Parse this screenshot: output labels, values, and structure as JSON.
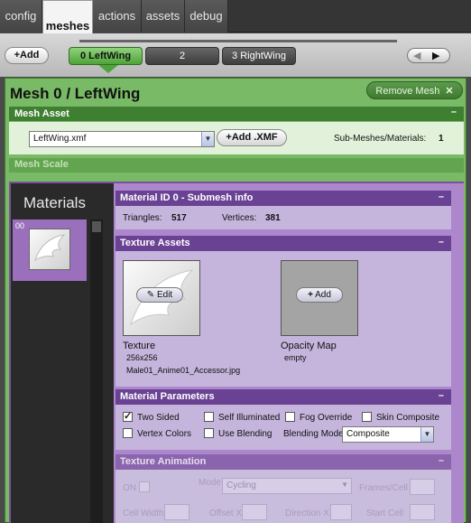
{
  "tabs": [
    "config",
    "meshes",
    "actions",
    "assets",
    "debug"
  ],
  "add_label": "Add",
  "mesh_tabs": [
    "0 LeftWing",
    "2",
    "3 RightWing"
  ],
  "title": "Mesh 0 / LeftWing",
  "remove_mesh": "Remove Mesh",
  "mesh_asset": {
    "header": "Mesh Asset",
    "file": "LeftWing.xmf",
    "add_xmf": "Add .XMF",
    "submesh_label": "Sub-Meshes/Materials:",
    "submesh_count": "1"
  },
  "mesh_scale": "Mesh Scale",
  "materials": {
    "title": "Materials",
    "thumb_index": "00"
  },
  "submesh": {
    "header": "Material ID 0 - Submesh info",
    "triangles_label": "Triangles:",
    "triangles": "517",
    "vertices_label": "Vertices:",
    "vertices": "381"
  },
  "texture_assets": {
    "header": "Texture Assets",
    "edit": "Edit",
    "texture_label": "Texture",
    "texture_size": "256x256",
    "texture_file": "Male01_Anime01_Accessor.jpg",
    "add": "Add",
    "opacity_label": "Opacity Map",
    "opacity_value": "empty"
  },
  "params": {
    "header": "Material Parameters",
    "two_sided": "Two Sided",
    "self_illuminated": "Self Illuminated",
    "fog_override": "Fog Override",
    "skin_composite": "Skin Composite",
    "vertex_colors": "Vertex Colors",
    "use_blending": "Use Blending",
    "blending_mode_label": "Blending Mode",
    "blending_mode": "Composite",
    "two_sided_checked": true
  },
  "animation": {
    "header": "Texture Animation",
    "on": "ON",
    "mode_label": "Mode",
    "mode_value": "Cycling",
    "frames_cell": "Frames/Cell",
    "cell_width": "Cell Width",
    "offset_x": "Offset X",
    "direction_x": "Direction X",
    "start_cell": "Start Cell"
  },
  "collapse_glyph": "–",
  "close_glyph": "✕",
  "plus_glyph": "+",
  "check_glyph": "✓",
  "dropdown_glyph": "▼",
  "left_glyph": "◀",
  "right_glyph": "▶",
  "pencil_glyph": "✎",
  "colors": {
    "green_header": "#3f7f32",
    "purple_header": "#6a4294",
    "panel_green": "#79ba66"
  }
}
